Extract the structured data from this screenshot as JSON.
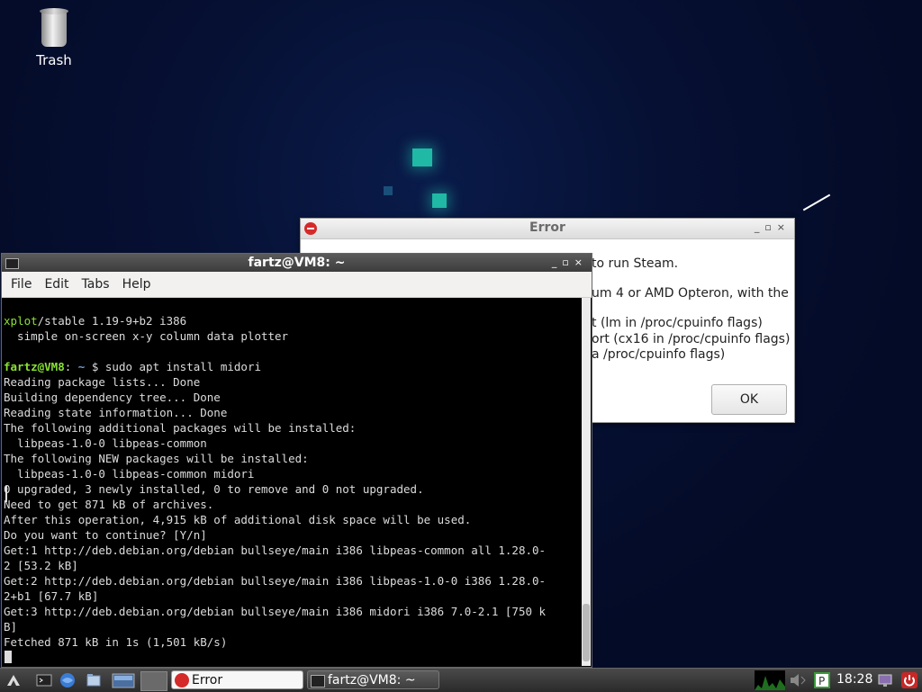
{
  "desktop": {
    "trash_label": "Trash"
  },
  "error_dialog": {
    "title": "Error",
    "lines": [
      "to run Steam.",
      "um 4 or AMD Opteron, with the",
      "t (lm in /proc/cpuinfo flags)",
      "ort (cx16 in /proc/cpuinfo flags)",
      "a /proc/cpuinfo flags)"
    ],
    "ok_label": "OK"
  },
  "terminal": {
    "title": "fartz@VM8: ~",
    "menu": [
      "File",
      "Edit",
      "Tabs",
      "Help"
    ],
    "pkg_name": "xplot",
    "pkg_rest": "/stable 1.19-9+b2 i386",
    "pkg_desc": "  simple on-screen x-y column data plotter",
    "prompt_user": "fartz@VM8",
    "prompt_sep": ":",
    "prompt_path": " ~",
    "prompt_cmd": " $ sudo apt install midori",
    "output": [
      "Reading package lists... Done",
      "Building dependency tree... Done",
      "Reading state information... Done",
      "The following additional packages will be installed:",
      "  libpeas-1.0-0 libpeas-common",
      "The following NEW packages will be installed:",
      "  libpeas-1.0-0 libpeas-common midori",
      "0 upgraded, 3 newly installed, 0 to remove and 0 not upgraded.",
      "Need to get 871 kB of archives.",
      "After this operation, 4,915 kB of additional disk space will be used.",
      "Do you want to continue? [Y/n]",
      "Get:1 http://deb.debian.org/debian bullseye/main i386 libpeas-common all 1.28.0-",
      "2 [53.2 kB]",
      "Get:2 http://deb.debian.org/debian bullseye/main i386 libpeas-1.0-0 i386 1.28.0-",
      "2+b1 [67.7 kB]",
      "Get:3 http://deb.debian.org/debian bullseye/main i386 midori i386 7.0-2.1 [750 k",
      "B]",
      "Fetched 871 kB in 1s (1,501 kB/s)"
    ]
  },
  "taskbar": {
    "tasks": [
      {
        "label": "Error"
      },
      {
        "label": "fartz@VM8: ~"
      }
    ],
    "clock": "18:28"
  },
  "colors": {
    "desktop_bg": "#050d2e",
    "prompt_green": "#8ae234",
    "prompt_blue": "#729fcf",
    "error_red": "#d42a2a"
  }
}
